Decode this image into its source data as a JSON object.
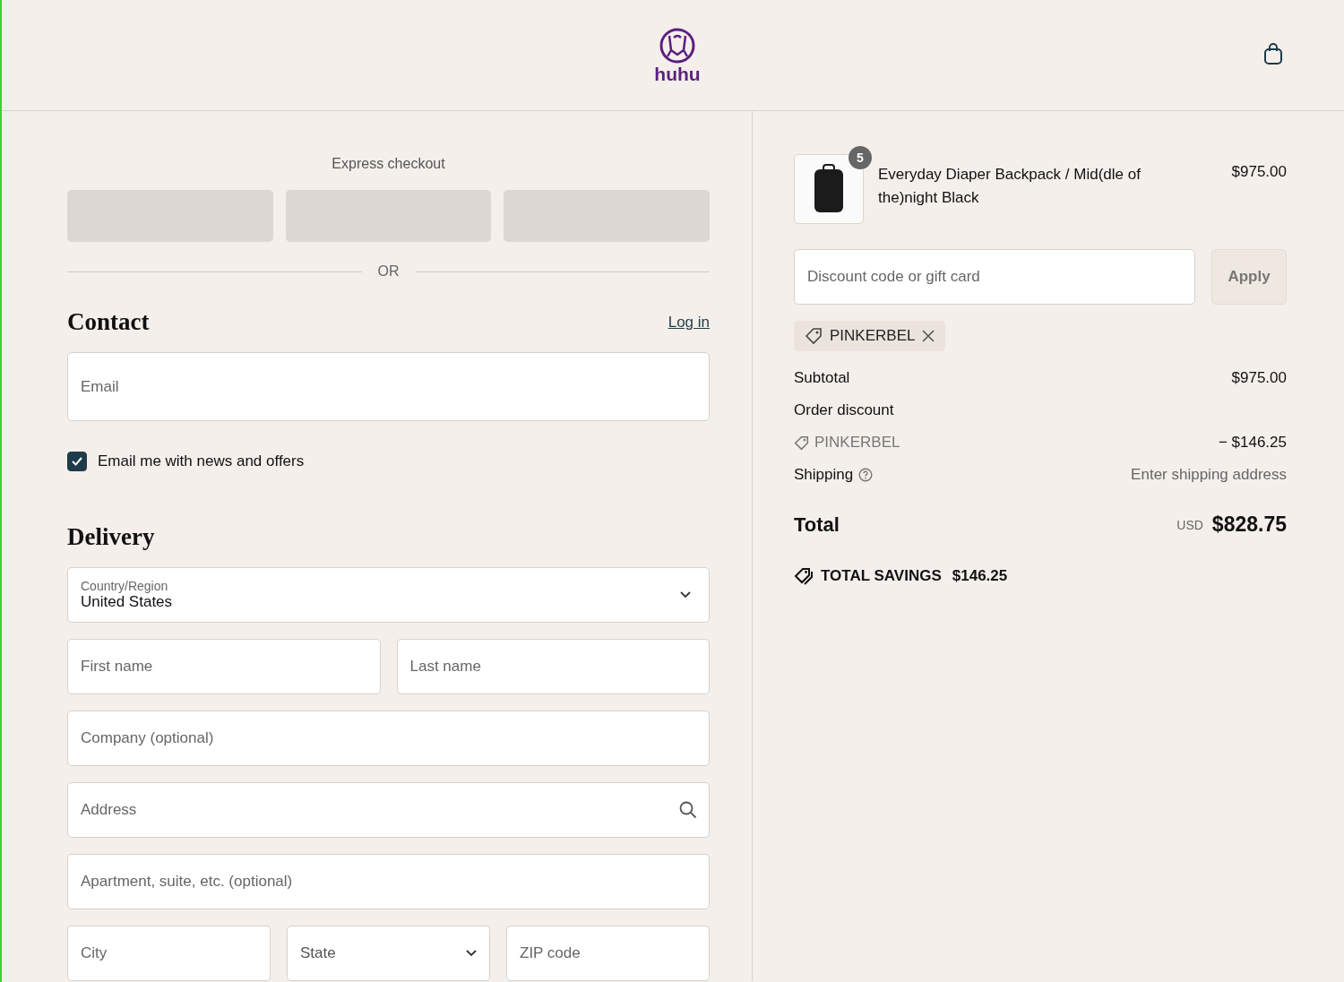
{
  "header": {
    "logo_text": "huhu"
  },
  "express_checkout": {
    "title": "Express checkout",
    "divider": "OR"
  },
  "contact": {
    "heading": "Contact",
    "login_link": "Log in",
    "email_placeholder": "Email",
    "newsletter": {
      "label": "Email me with news and offers",
      "checked": true
    }
  },
  "delivery": {
    "heading": "Delivery",
    "country": {
      "label": "Country/Region",
      "value": "United States"
    },
    "rows": [
      [
        {
          "kind": "text",
          "placeholder": "First name"
        },
        {
          "kind": "text",
          "placeholder": "Last name"
        }
      ],
      [
        {
          "kind": "text",
          "placeholder": "Company (optional)"
        }
      ],
      [
        {
          "kind": "search",
          "placeholder": "Address"
        }
      ],
      [
        {
          "kind": "text",
          "placeholder": "Apartment, suite, etc. (optional)"
        }
      ],
      [
        {
          "kind": "text",
          "placeholder": "City"
        },
        {
          "kind": "select",
          "placeholder": "State"
        },
        {
          "kind": "text",
          "placeholder": "ZIP code"
        }
      ]
    ]
  },
  "summary": {
    "item": {
      "quantity": "5",
      "name": "Everyday Diaper Backpack / Mid(dle of the)night Black",
      "price": "$975.00"
    },
    "discount": {
      "placeholder": "Discount code or gift card",
      "button": "Apply",
      "applied_code": "PINKERBEL"
    },
    "lines": [
      {
        "kind": "plain",
        "label": "Subtotal",
        "value": "$975.00"
      },
      {
        "kind": "plain",
        "label": "Order discount"
      },
      {
        "kind": "code",
        "label": "PINKERBEL",
        "value": "− $146.25"
      },
      {
        "kind": "help",
        "label": "Shipping",
        "value": "Enter shipping address"
      }
    ],
    "total": {
      "label": "Total",
      "currency": "USD",
      "amount": "$828.75"
    },
    "savings": {
      "label": "TOTAL SAVINGS",
      "amount": "$146.25"
    }
  }
}
